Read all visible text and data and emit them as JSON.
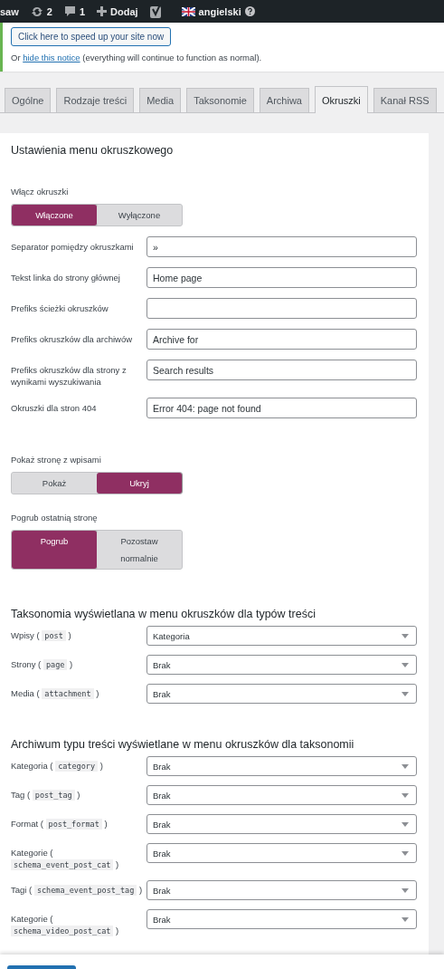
{
  "admin_bar": {
    "site": "saw",
    "updates": "2",
    "comments": "1",
    "new": "Dodaj",
    "language": "angielski"
  },
  "notice": {
    "button": "Click here to speed up your site now",
    "before": "Or",
    "link": "hide this notice",
    "after": "(everything will continue to function as normal)."
  },
  "tabs": [
    {
      "label": "Ogólne",
      "selected": false
    },
    {
      "label": "Rodzaje treści",
      "selected": false
    },
    {
      "label": "Media",
      "selected": false
    },
    {
      "label": "Taksonomie",
      "selected": false
    },
    {
      "label": "Archiwa",
      "selected": false
    },
    {
      "label": "Okruszki",
      "selected": true
    },
    {
      "label": "Kanał RSS",
      "selected": false
    }
  ],
  "section_title": "Ustawienia menu okruszkowego",
  "enable": {
    "label": "Włącz okruszki",
    "options": [
      {
        "label": "Włączone",
        "selected": true
      },
      {
        "label": "Wyłączone",
        "selected": false
      }
    ]
  },
  "fields": [
    {
      "label": "Separator pomiędzy okruszkami",
      "value": "»"
    },
    {
      "label": "Tekst linka do strony głównej",
      "value": "Home page"
    },
    {
      "label": "Prefiks ścieżki okruszków"
    },
    {
      "label": "Prefiks okruszków dla archiwów",
      "value": "Archive for"
    },
    {
      "label": "Prefiks okruszków dla strony z wynikami wyszukiwania",
      "value": "Search results"
    },
    {
      "label": "Okruszki dla stron 404",
      "value": "Error 404: page not found"
    }
  ],
  "toggles": [
    {
      "label": "Pokaż stronę z wpisami",
      "options": [
        {
          "label": "Pokaż",
          "selected": false
        },
        {
          "label": "Ukryj",
          "selected": true
        }
      ]
    },
    {
      "label": "Pogrub ostatnią stronę",
      "options": [
        {
          "label": "Pogrub",
          "selected": true
        },
        {
          "label": "Pozostaw normalnie",
          "selected": false
        }
      ]
    }
  ],
  "groups": [
    {
      "title": "Taksonomia wyświetlana w menu okruszków dla typów treści",
      "rows": [
        {
          "before": "Wpisy (",
          "code": "post",
          "after": ")",
          "value": "Kategoria"
        },
        {
          "before": "Strony (",
          "code": "page",
          "after": ")",
          "value": "Brak"
        },
        {
          "before": "Media (",
          "code": "attachment",
          "after": ")",
          "value": "Brak"
        }
      ]
    },
    {
      "title": "Archiwum typu treści wyświetlane w menu okruszków dla taksonomii",
      "rows": [
        {
          "before": "Kategoria (",
          "code": "category",
          "after": ")",
          "value": "Brak"
        },
        {
          "before": "Tag (",
          "code": "post_tag",
          "after": ")",
          "value": "Brak"
        },
        {
          "before": "Format (",
          "code": "post_format",
          "after": ")",
          "value": "Brak"
        },
        {
          "before": "Kategorie (",
          "code": "schema_event_post_cat",
          "after": ")",
          "value": "Brak"
        },
        {
          "before": "Tagi (",
          "code": "schema_event_post_tag",
          "after": ")",
          "value": "Brak"
        },
        {
          "before": "Kategorie (",
          "code": "schema_video_post_cat",
          "after": ")",
          "value": "Brak"
        }
      ]
    }
  ]
}
